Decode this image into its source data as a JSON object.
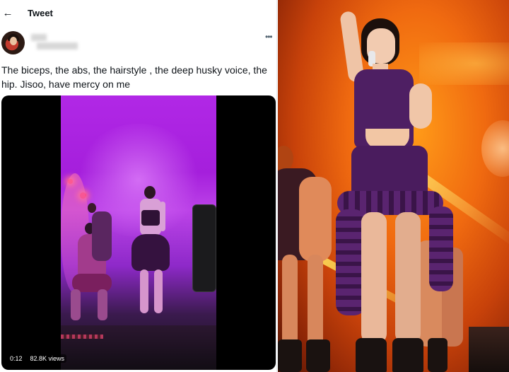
{
  "tweet": {
    "back_icon": "left-arrow-icon",
    "header_title": "Tweet",
    "more_icon": "more-horizontal-icon",
    "text": "The biceps, the abs, the hairstyle , the deep husky voice, the hip. Jisoo, have mercy on me",
    "video": {
      "elapsed": "0:12",
      "views": "82.8K views"
    }
  },
  "colors": {
    "text": "#0f1419",
    "secondary": "#536471",
    "video_bg": "#000000",
    "stage_purple": "#b128e6",
    "concert_orange": "#f06a10",
    "dress_purple": "#4e1f63"
  }
}
